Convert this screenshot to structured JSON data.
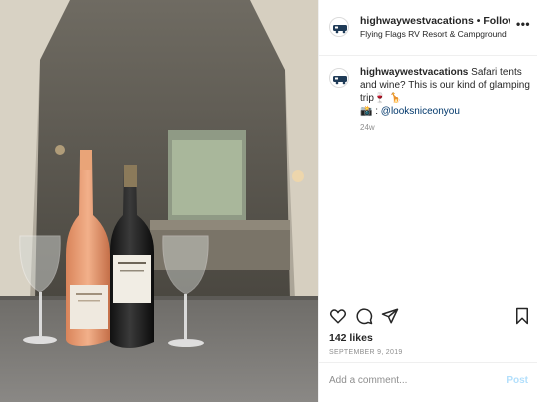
{
  "post": {
    "username": "highwaywestvacations",
    "separator": "•",
    "follow_label": "Following",
    "location": "Flying Flags RV Resort & Campground",
    "more_icon": "more-horizontal-icon"
  },
  "caption": {
    "username": "highwaywestvacations",
    "text": "Safari tents and wine? This is our kind of glamping trip🍷 🦒",
    "credit_prefix": "📸 : ",
    "mention": "@looksniceonyou",
    "time_ago": "24w"
  },
  "actions": {
    "like_icon": "heart-icon",
    "comment_icon": "comment-icon",
    "share_icon": "send-icon",
    "save_icon": "bookmark-icon"
  },
  "likes": "142 likes",
  "date": "SEPTEMBER 9, 2019",
  "add_comment": {
    "placeholder": "Add a comment...",
    "post_label": "Post"
  },
  "colors": {
    "link": "#00376b",
    "muted": "#8e8e8e",
    "post_button_disabled": "#b2dffc",
    "border": "#efefef"
  }
}
